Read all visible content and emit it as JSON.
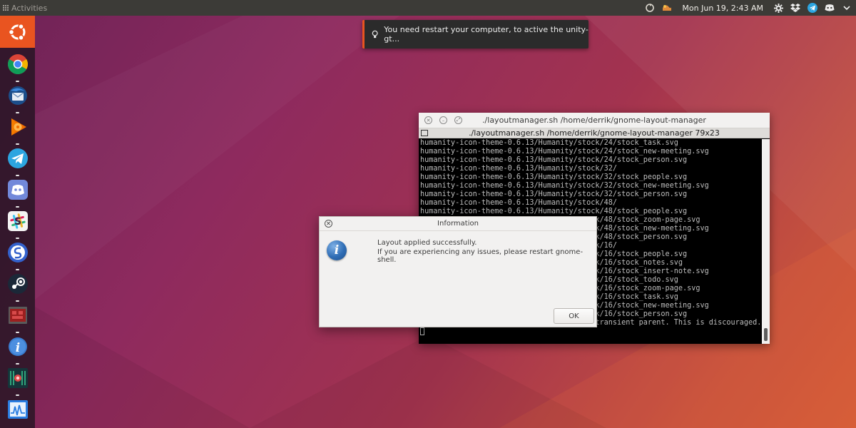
{
  "topbar": {
    "activities_label": "Activities",
    "clock": "Mon Jun 19,  2:43 AM",
    "tray_icons": [
      "sync-icon",
      "app-indicator-icon",
      "gear-icon",
      "dropbox-icon",
      "telegram-icon",
      "discord-icon",
      "chevron-down-icon"
    ]
  },
  "dock": {
    "apps": [
      "ubuntu-logo",
      "chrome",
      "thunderbird",
      "google-play-music",
      "telegram",
      "discord",
      "slack",
      "simplenote",
      "steam",
      "screencast",
      "info",
      "gnome-layout-manager",
      "system-monitor"
    ]
  },
  "notification": {
    "text": "You need restart your computer, to active the unity-gt..."
  },
  "terminal": {
    "title": "./layoutmanager.sh  /home/derrik/gnome-layout-manager",
    "tab_label": "./layoutmanager.sh  /home/derrik/gnome-layout-manager 79x23",
    "lines": [
      "humanity-icon-theme-0.6.13/Humanity/stock/24/stock_task.svg",
      "humanity-icon-theme-0.6.13/Humanity/stock/24/stock_new-meeting.svg",
      "humanity-icon-theme-0.6.13/Humanity/stock/24/stock_person.svg",
      "humanity-icon-theme-0.6.13/Humanity/stock/32/",
      "humanity-icon-theme-0.6.13/Humanity/stock/32/stock_people.svg",
      "humanity-icon-theme-0.6.13/Humanity/stock/32/stock_new-meeting.svg",
      "humanity-icon-theme-0.6.13/Humanity/stock/32/stock_person.svg",
      "humanity-icon-theme-0.6.13/Humanity/stock/48/",
      "humanity-icon-theme-0.6.13/Humanity/stock/48/stock_people.svg",
      "humanity-icon-theme-0.6.13/Humanity/stock/48/stock_zoom-page.svg",
      "humanity-icon-theme-0.6.13/Humanity/stock/48/stock_new-meeting.svg",
      "humanity-icon-theme-0.6.13/Humanity/stock/48/stock_person.svg",
      "humanity-icon-theme-0.6.13/Humanity/stock/16/",
      "humanity-icon-theme-0.6.13/Humanity/stock/16/stock_people.svg",
      "humanity-icon-theme-0.6.13/Humanity/stock/16/stock_notes.svg",
      "humanity-icon-theme-0.6.13/Humanity/stock/16/stock_insert-note.svg",
      "humanity-icon-theme-0.6.13/Humanity/stock/16/stock_todo.svg",
      "humanity-icon-theme-0.6.13/Humanity/stock/16/stock_zoom-page.svg",
      "humanity-icon-theme-0.6.13/Humanity/stock/16/stock_task.svg",
      "humanity-icon-theme-0.6.13/Humanity/stock/16/stock_new-meeting.svg",
      "humanity-icon-theme-0.6.13/Humanity/stock/16/stock_person.svg",
      "Gtk-Message: GtkDialog mapped without a transient parent. This is discouraged."
    ]
  },
  "dialog": {
    "title": "Information",
    "message_line1": "Layout applied successfully.",
    "message_line2": "If you are experiencing any issues, please restart gnome-shell.",
    "ok_label": "OK"
  },
  "colors": {
    "accent": "#e95420",
    "topbar": "#3c3b37",
    "dock": "#2a1626",
    "dialog_bg": "#f2f1f0",
    "terminal_bg": "#000000"
  }
}
